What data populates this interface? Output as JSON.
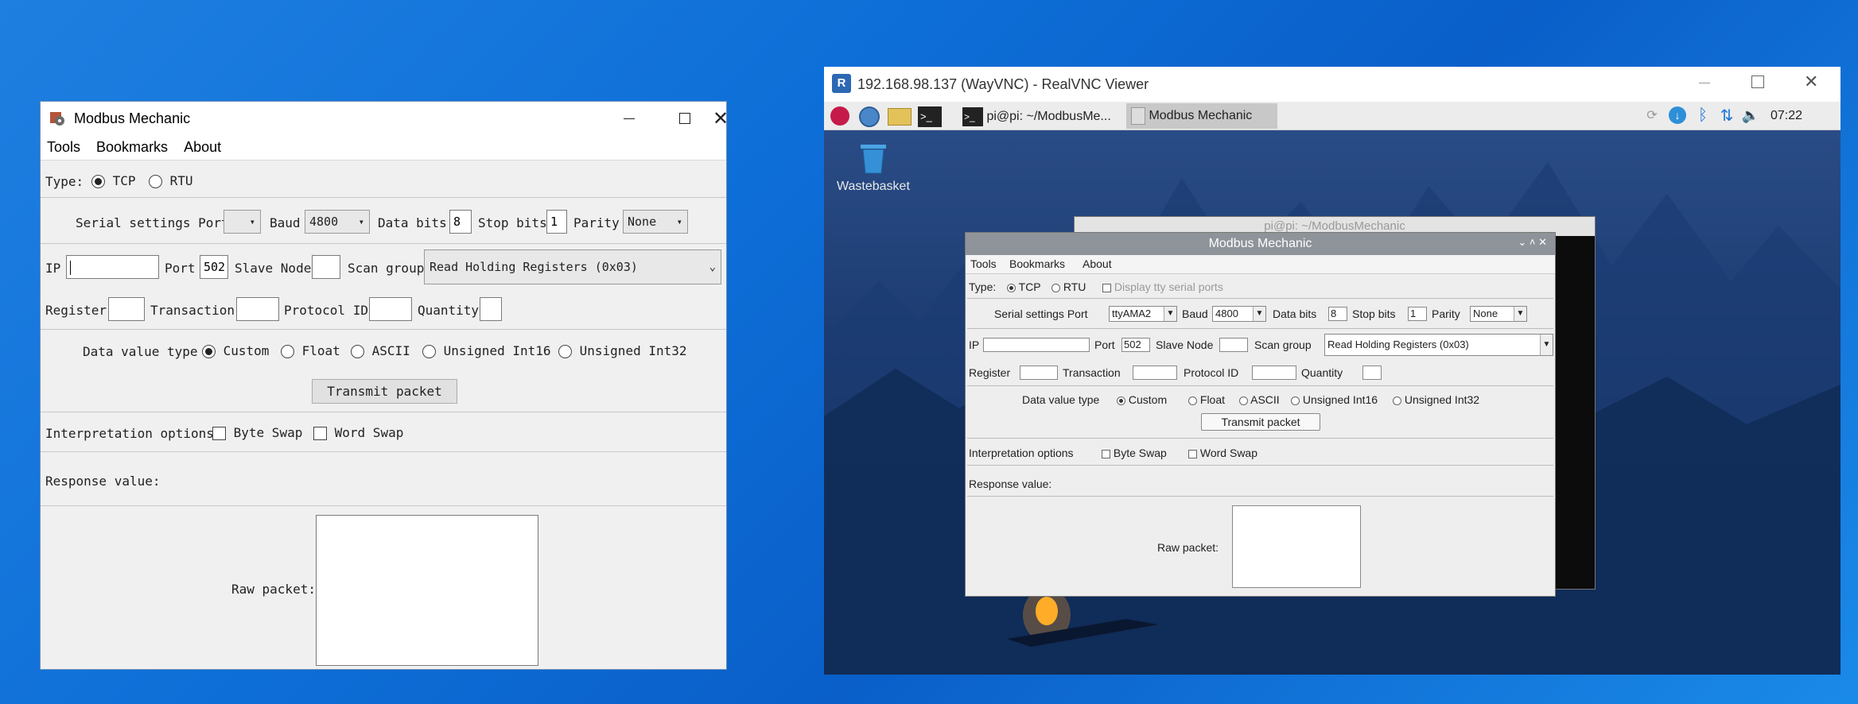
{
  "left_window": {
    "title": "Modbus Mechanic",
    "menu": [
      "Tools",
      "Bookmarks",
      "About"
    ],
    "type_label": "Type:",
    "type_options": [
      "TCP",
      "RTU"
    ],
    "serial_label": "Serial settings Port",
    "baud_label": "Baud",
    "baud_value": "4800",
    "databits_label": "Data bits",
    "databits_value": "8",
    "stopbits_label": "Stop bits",
    "stopbits_value": "1",
    "parity_label": "Parity",
    "parity_value": "None",
    "ip_label": "IP",
    "port_label": "Port",
    "port_value": "502",
    "slave_label": "Slave Node",
    "scan_label": "Scan group",
    "scan_value": "Read Holding Registers (0x03)",
    "register_label": "Register",
    "transaction_label": "Transaction",
    "protocol_label": "Protocol ID",
    "quantity_label": "Quantity",
    "dvt_label": "Data value type",
    "dvt_options": [
      "Custom",
      "Float",
      "ASCII",
      "Unsigned Int16",
      "Unsigned Int32"
    ],
    "transmit_label": "Transmit packet",
    "interp_label": "Interpretation options",
    "byteswap_label": "Byte Swap",
    "wordswap_label": "Word Swap",
    "response_label": "Response value:",
    "raw_label": "Raw packet:"
  },
  "vnc_window": {
    "title": "192.168.98.137 (WayVNC) - RealVNC Viewer",
    "taskbar_terminal": "pi@pi: ~/ModbusMe...",
    "taskbar_app": "Modbus Mechanic",
    "clock": "07:22",
    "wastebasket": "Wastebasket",
    "bg_terminal_title": "pi@pi: ~/ModbusMechanic",
    "app": {
      "title": "Modbus Mechanic",
      "menu": [
        "Tools",
        "Bookmarks",
        "About"
      ],
      "type_label": "Type:",
      "type_options": [
        "TCP",
        "RTU"
      ],
      "display_tty": "Display tty serial ports",
      "serial_label": "Serial settings Port",
      "port_value": "ttyAMA2",
      "baud_label": "Baud",
      "baud_value": "4800",
      "databits_label": "Data bits",
      "databits_value": "8",
      "stopbits_label": "Stop bits",
      "stopbits_value": "1",
      "parity_label": "Parity",
      "parity_value": "None",
      "ip_label": "IP",
      "tcp_port_label": "Port",
      "tcp_port_value": "502",
      "slave_label": "Slave Node",
      "scan_label": "Scan group",
      "scan_value": "Read Holding Registers (0x03)",
      "register_label": "Register",
      "transaction_label": "Transaction",
      "protocol_label": "Protocol ID",
      "quantity_label": "Quantity",
      "dvt_label": "Data value type",
      "dvt_options": [
        "Custom",
        "Float",
        "ASCII",
        "Unsigned Int16",
        "Unsigned Int32"
      ],
      "transmit_label": "Transmit packet",
      "interp_label": "Interpretation options",
      "byteswap_label": "Byte Swap",
      "wordswap_label": "Word Swap",
      "response_label": "Response value:",
      "raw_label": "Raw packet:"
    }
  }
}
